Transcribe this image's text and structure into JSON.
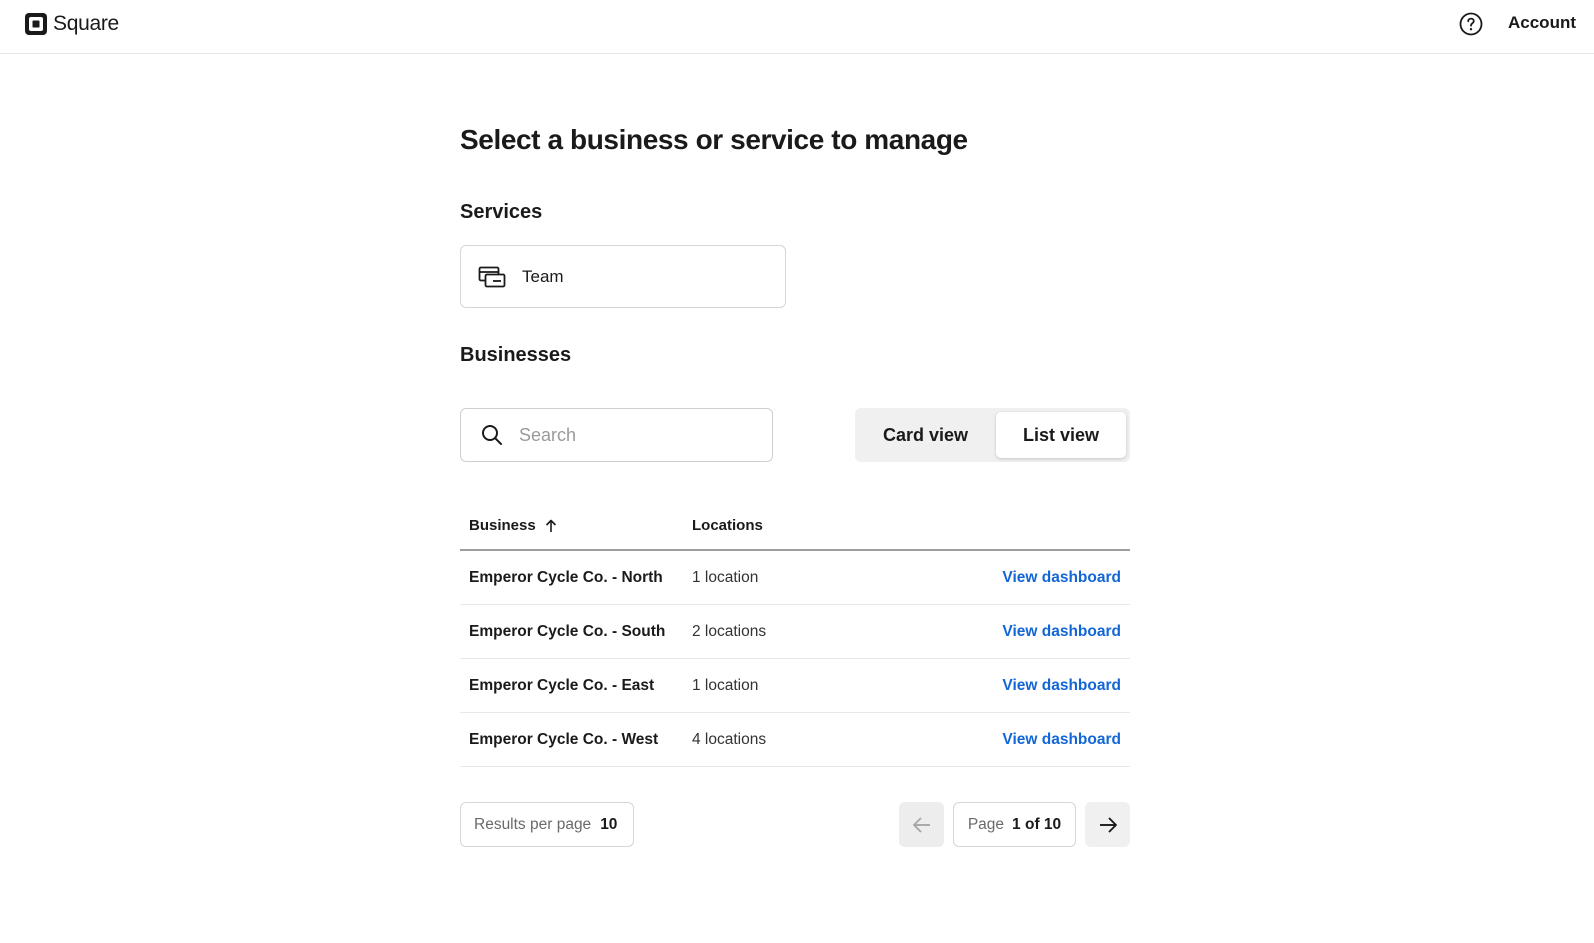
{
  "header": {
    "brand": "Square",
    "account_label": "Account",
    "icons": {
      "logo": "square-logo-icon",
      "help": "help-circle-icon"
    }
  },
  "main": {
    "title": "Select a business or service to manage",
    "services": {
      "title": "Services",
      "items": [
        {
          "label": "Team",
          "icon": "team-card-icon"
        }
      ]
    },
    "businesses": {
      "title": "Businesses",
      "search": {
        "placeholder": "Search",
        "value": ""
      },
      "view_toggle": {
        "card_label": "Card view",
        "list_label": "List view",
        "selected": "List view"
      },
      "table": {
        "columns": [
          {
            "label": "Business",
            "sort": "ascending"
          },
          {
            "label": "Locations"
          }
        ],
        "rows": [
          {
            "name": "Emperor Cycle Co. - North",
            "locations": "1 location",
            "action": "View dashboard"
          },
          {
            "name": "Emperor Cycle Co. - South",
            "locations": "2 locations",
            "action": "View dashboard"
          },
          {
            "name": "Emperor Cycle Co. - East",
            "locations": "1 location",
            "action": "View dashboard"
          },
          {
            "name": "Emperor Cycle Co. - West",
            "locations": "4 locations",
            "action": "View dashboard"
          }
        ]
      },
      "pagination": {
        "results_label": "Results per page",
        "results_value": "10",
        "page_label": "Page",
        "page_value": "1 of 10",
        "prev_disabled": true
      }
    }
  },
  "colors": {
    "link": "#1266d6",
    "text": "#1a1a1a",
    "border": "#d6d6d6",
    "toggle_bg": "#f0f0f0"
  }
}
